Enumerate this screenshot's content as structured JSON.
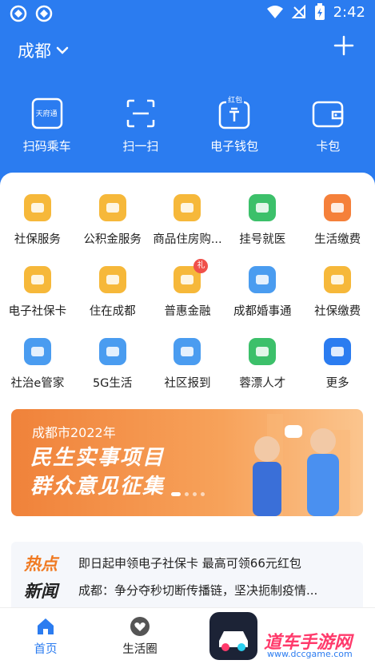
{
  "status_bar": {
    "time": "2:42"
  },
  "header": {
    "city": "成都"
  },
  "quick_actions": [
    {
      "label": "扫码乘车",
      "badge": "天府通"
    },
    {
      "label": "扫一扫"
    },
    {
      "label": "电子钱包",
      "badge": "红包"
    },
    {
      "label": "卡包"
    }
  ],
  "services": [
    {
      "label": "社保服务",
      "icon": "shield-check-icon",
      "color": "#f6b83a"
    },
    {
      "label": "公积金服务",
      "icon": "house-yen-icon",
      "color": "#f6b83a"
    },
    {
      "label": "商品住房购...",
      "icon": "house-pen-icon",
      "color": "#f6b83a"
    },
    {
      "label": "挂号就医",
      "icon": "medical-cross-icon",
      "color": "#3cc06a"
    },
    {
      "label": "生活缴费",
      "icon": "flame-bolt-icon",
      "color": "#f5803a"
    },
    {
      "label": "电子社保卡",
      "icon": "shield-card-icon",
      "color": "#f6b83a"
    },
    {
      "label": "住在成都",
      "icon": "panda-house-icon",
      "color": "#f6b83a"
    },
    {
      "label": "普惠金融",
      "icon": "coins-icon",
      "color": "#f6b83a",
      "badge": "礼"
    },
    {
      "label": "成都婚事通",
      "icon": "heart-ribbon-icon",
      "color": "#4a9cf0"
    },
    {
      "label": "社保缴费",
      "icon": "wallet-pay-icon",
      "color": "#f6b83a"
    },
    {
      "label": "社治e管家",
      "icon": "community-icon",
      "color": "#4a9cf0"
    },
    {
      "label": "5G生活",
      "icon": "5g-icon",
      "color": "#4a9cf0"
    },
    {
      "label": "社区报到",
      "icon": "check-in-icon",
      "color": "#4a9cf0"
    },
    {
      "label": "蓉漂人才",
      "icon": "talent-icon",
      "color": "#3cc06a"
    },
    {
      "label": "更多",
      "icon": "grid-more-icon",
      "color": "#2b7cf0"
    }
  ],
  "banner": {
    "year": "成都市2022年",
    "title1": "民生实事项目",
    "title2": "群众意见征集"
  },
  "news": {
    "tag1": "热点",
    "tag2": "新闻",
    "line1": "即日起申领电子社保卡 最高可领66元红包",
    "line2": "成都：争分夺秒切断传播链，坚决扼制疫情..."
  },
  "tabs": [
    {
      "label": "首页",
      "active": true
    },
    {
      "label": "生活圈"
    }
  ],
  "watermark": {
    "text": "道车手游网",
    "sub": "www.dccgame.com"
  }
}
